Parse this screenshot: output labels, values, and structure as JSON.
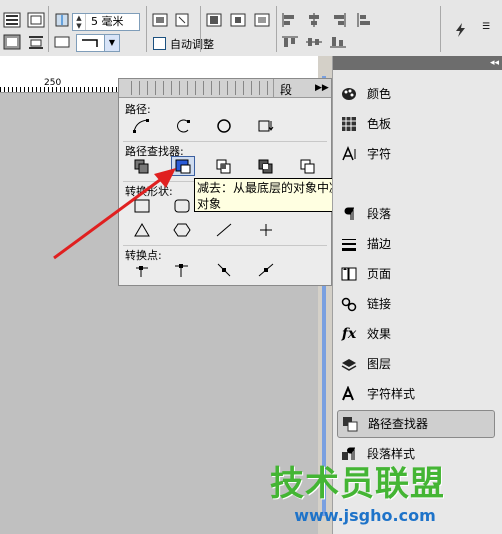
{
  "toolbar": {
    "size_value": "5 毫米",
    "autoadjust_label": "自动调整",
    "lightning_icon": "lightning-icon"
  },
  "ruler": {
    "label": "250"
  },
  "pathfinder": {
    "tab_label": "段",
    "path_label": "路径:",
    "finder_label": "路径查找器:",
    "convert_shape_label": "转换形状:",
    "convert_point_label": "转换点:"
  },
  "tooltip": {
    "text": "减去：从最底层的对象中减去最顶层的对象"
  },
  "right_panel": {
    "items": [
      {
        "label": "颜色",
        "icon": "palette-icon"
      },
      {
        "label": "色板",
        "icon": "swatches-icon"
      },
      {
        "label": "字符",
        "icon": "character-icon"
      },
      {
        "label": "段落",
        "icon": "paragraph-icon"
      },
      {
        "label": "描边",
        "icon": "stroke-icon"
      },
      {
        "label": "页面",
        "icon": "pages-icon"
      },
      {
        "label": "链接",
        "icon": "links-icon"
      },
      {
        "label": "效果",
        "icon": "effects-icon"
      },
      {
        "label": "图层",
        "icon": "layers-icon"
      },
      {
        "label": "字符样式",
        "icon": "character-style-icon"
      },
      {
        "label": "路径查找器",
        "icon": "pathfinder-icon"
      },
      {
        "label": "段落样式",
        "icon": "paragraph-style-icon"
      }
    ],
    "selected_index": 10
  },
  "watermark": {
    "main": "技术员联盟",
    "url": "www.jsgho.com"
  }
}
